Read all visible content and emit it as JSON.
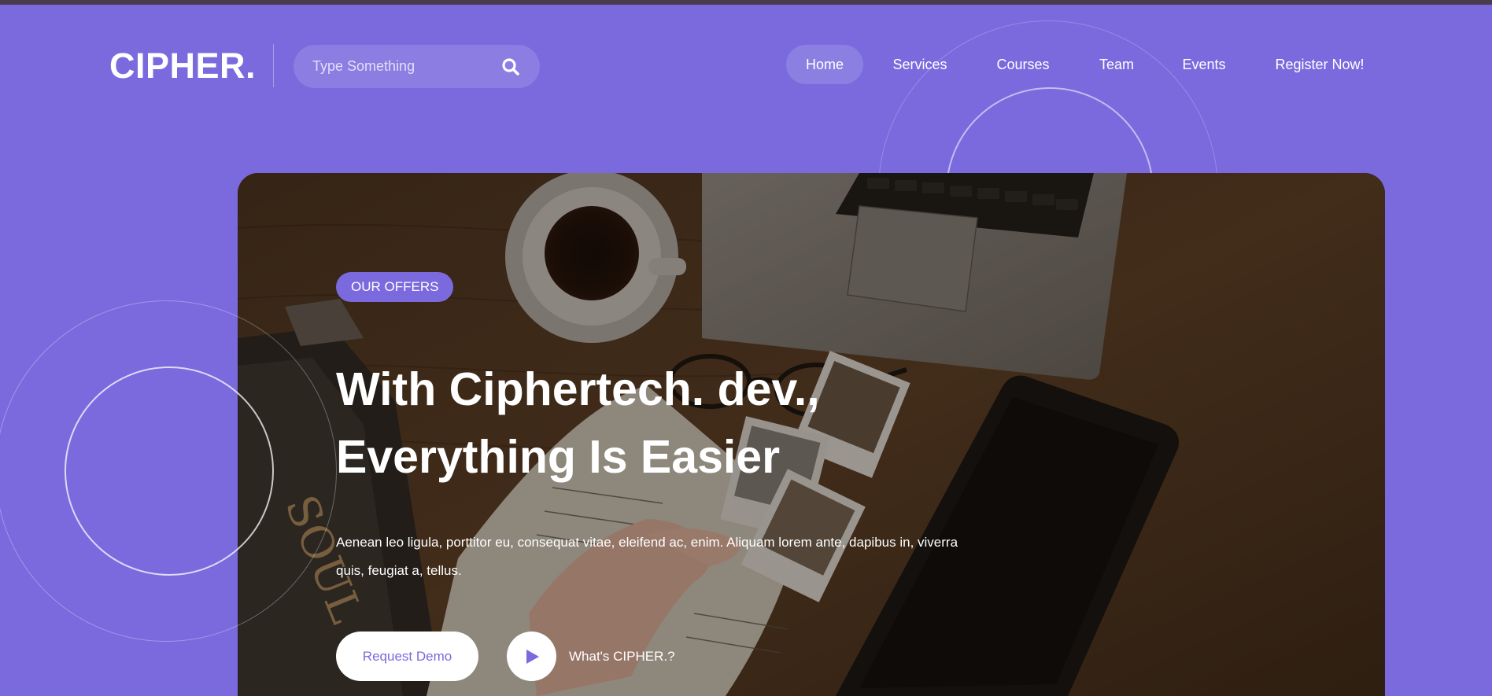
{
  "brand": {
    "logo": "CIPHER.",
    "accent_color": "#7a6ade"
  },
  "search": {
    "placeholder": "Type Something",
    "icon": "search-icon"
  },
  "nav": {
    "items": [
      {
        "label": "Home",
        "active": true
      },
      {
        "label": "Services",
        "active": false
      },
      {
        "label": "Courses",
        "active": false
      },
      {
        "label": "Team",
        "active": false
      },
      {
        "label": "Events",
        "active": false
      },
      {
        "label": "Register Now!",
        "active": false
      }
    ]
  },
  "hero": {
    "badge": "OUR OFFERS",
    "headline_line1": "With Ciphertech. dev.,",
    "headline_line2": "Everything Is Easier",
    "description": "Aenean leo ligula, porttitor eu, consequat vitae, eleifend ac, enim. Aliquam lorem ante, dapibus in, viverra quis, feugiat a, tellus.",
    "primary_button": "Request Demo",
    "video_button_icon": "play-icon",
    "video_label": "What's CIPHER.?"
  }
}
